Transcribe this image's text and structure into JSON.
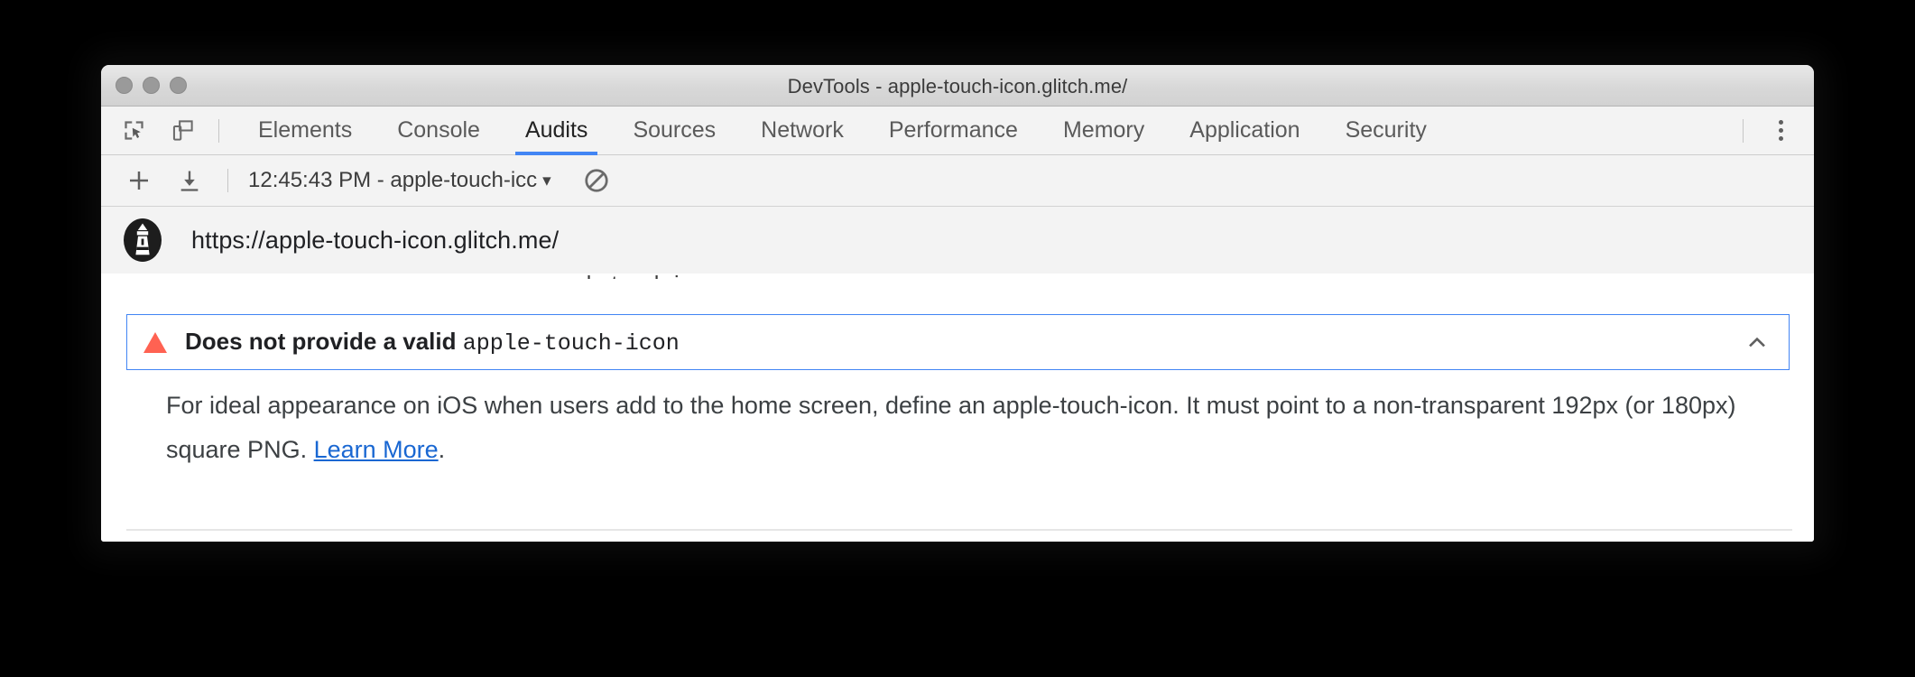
{
  "window": {
    "title": "DevTools - apple-touch-icon.glitch.me/",
    "traffic_lights": [
      "close-button",
      "minimize-button",
      "zoom-button"
    ]
  },
  "tabstrip": {
    "inspect_icon": "inspect-element-icon",
    "device_icon": "device-toolbar-icon",
    "tabs": [
      {
        "label": "Elements",
        "selected": false
      },
      {
        "label": "Console",
        "selected": false
      },
      {
        "label": "Audits",
        "selected": true
      },
      {
        "label": "Sources",
        "selected": false
      },
      {
        "label": "Network",
        "selected": false
      },
      {
        "label": "Performance",
        "selected": false
      },
      {
        "label": "Memory",
        "selected": false
      },
      {
        "label": "Application",
        "selected": false
      },
      {
        "label": "Security",
        "selected": false
      }
    ],
    "menu_icon": "more-options-icon",
    "selected_underline_color": "#4285f4"
  },
  "audit_toolbar": {
    "add_icon": "plus-icon",
    "export_icon": "download-icon",
    "report_select_value": "12:45:43 PM - apple-touch-icc",
    "report_select_caret": "▾",
    "clear_icon": "clear-all-icon"
  },
  "url_row": {
    "logo_icon": "lighthouse-logo-icon",
    "url": "https://apple-touch-icon.glitch.me/"
  },
  "results": {
    "clipped_text_above": "apple-touch-icon",
    "audit": {
      "status_icon": "warning-triangle-icon",
      "status_color": "#ff6252",
      "title_prefix": "Does not provide a valid ",
      "title_code": "apple-touch-icon",
      "collapse_icon": "chevron-up-icon",
      "border_color": "#4285f4",
      "description_part1": "For ideal appearance on iOS when users add to the home screen, define an apple-touch-icon. It must point to a non-transparent 192px (or 180px) square PNG. ",
      "description_link": "Learn More",
      "description_part2": "."
    }
  }
}
